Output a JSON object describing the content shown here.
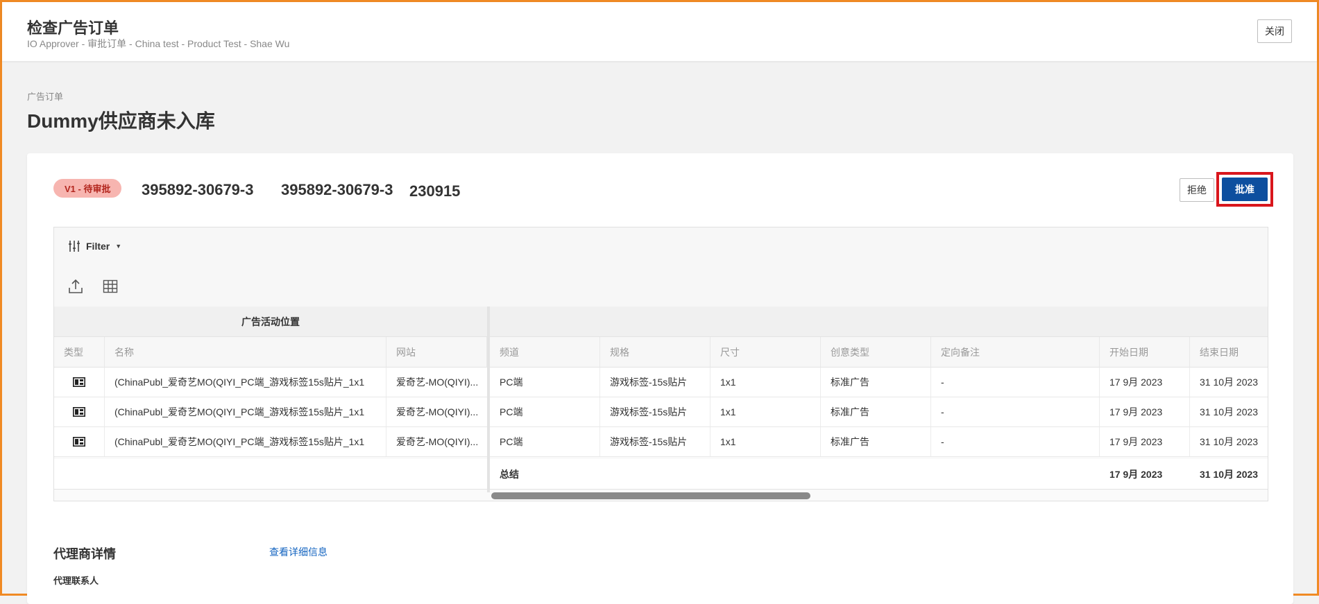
{
  "header": {
    "title": "检查广告订单",
    "subtitle": "IO Approver - 审批订单 - China test - Product Test - Shae Wu",
    "close_label": "关闭"
  },
  "breadcrumb": "广告订单",
  "page_title": "Dummy供应商未入库",
  "order": {
    "status_badge": "V1 - 待审批",
    "id_1": "395892-30679-3",
    "id_2": "395892-30679-3",
    "id_3": "230915",
    "reject_label": "拒绝",
    "approve_label": "批准"
  },
  "colors": {
    "accent_blue": "#0d4f9f",
    "badge_bg": "#f7b5b0",
    "highlight_red": "#d9161c",
    "link_blue": "#1565c0"
  },
  "grid": {
    "filter_label": "Filter",
    "toolbar_icons": [
      "export-icon",
      "grid-layout-icon"
    ],
    "group_left_label": "广告活动位置",
    "columns_left": [
      "类型",
      "名称",
      "网站"
    ],
    "columns_right": [
      "频道",
      "规格",
      "尺寸",
      "创意类型",
      "定向备注",
      "开始日期",
      "结束日期"
    ],
    "rows": [
      {
        "type_icon": "placement-icon",
        "name": "(ChinaPubl_爱奇艺MO(QIYI_PC端_游戏标签15s贴片_1x1",
        "site": "爱奇艺-MO(QIYI)...",
        "channel": "PC端",
        "spec": "游戏标签-15s贴片",
        "size": "1x1",
        "creative": "标准广告",
        "targeting": "-",
        "start": "17 9月 2023",
        "end": "31 10月 2023"
      },
      {
        "type_icon": "placement-icon",
        "name": "(ChinaPubl_爱奇艺MO(QIYI_PC端_游戏标签15s贴片_1x1",
        "site": "爱奇艺-MO(QIYI)...",
        "channel": "PC端",
        "spec": "游戏标签-15s贴片",
        "size": "1x1",
        "creative": "标准广告",
        "targeting": "-",
        "start": "17 9月 2023",
        "end": "31 10月 2023"
      },
      {
        "type_icon": "placement-icon",
        "name": "(ChinaPubl_爱奇艺MO(QIYI_PC端_游戏标签15s贴片_1x1",
        "site": "爱奇艺-MO(QIYI)...",
        "channel": "PC端",
        "spec": "游戏标签-15s贴片",
        "size": "1x1",
        "creative": "标准广告",
        "targeting": "-",
        "start": "17 9月 2023",
        "end": "31 10月 2023"
      }
    ],
    "total": {
      "label": "总结",
      "start": "17 9月 2023",
      "end": "31 10月 2023"
    }
  },
  "agency": {
    "section_title": "代理商详情",
    "view_details_link": "查看详细信息",
    "contact_label": "代理联系人"
  }
}
